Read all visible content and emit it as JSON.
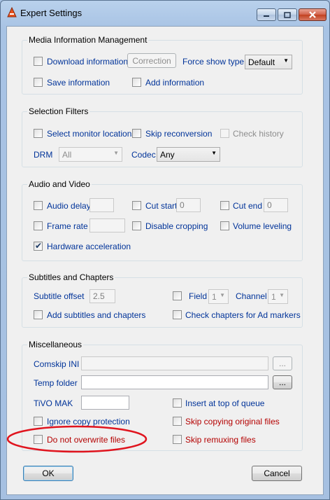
{
  "window": {
    "title": "Expert Settings",
    "minimize_icon": "minimize-icon",
    "maximize_icon": "maximize-icon",
    "close_icon": "close-icon"
  },
  "media": {
    "title": "Media Information Management",
    "download_information": "Download information",
    "correction_button": "Correction",
    "force_show_type_label": "Force show type",
    "force_show_type_value": "Default",
    "save_information": "Save information",
    "add_information": "Add information"
  },
  "selection": {
    "title": "Selection Filters",
    "select_monitor_locations": "Select monitor locations",
    "skip_reconversion": "Skip reconversion",
    "check_history": "Check history",
    "drm_label": "DRM",
    "drm_value": "All",
    "codec_label": "Codec",
    "codec_value": "Any"
  },
  "audio_video": {
    "title": "Audio and Video",
    "audio_delay": "Audio delay",
    "audio_delay_value": "",
    "cut_start": "Cut start",
    "cut_start_value": "0",
    "cut_end": "Cut end",
    "cut_end_value": "0",
    "frame_rate": "Frame rate",
    "frame_rate_value": "",
    "disable_cropping": "Disable cropping",
    "volume_leveling": "Volume leveling",
    "hardware_acceleration": "Hardware acceleration",
    "hardware_acceleration_checked": true
  },
  "subtitles": {
    "title": "Subtitles and Chapters",
    "subtitle_offset_label": "Subtitle offset",
    "subtitle_offset_value": "2.5",
    "field_label": "Field",
    "field_value": "1",
    "channel_label": "Channel",
    "channel_value": "1",
    "add_subtitles": "Add subtitles and chapters",
    "check_chapters": "Check chapters for Ad markers"
  },
  "misc": {
    "title": "Miscellaneous",
    "comskip_ini_label": "Comskip INI",
    "comskip_ini_value": "",
    "browse_label": "...",
    "temp_folder_label": "Temp folder",
    "temp_folder_value": "",
    "tivo_mak_label": "TiVO MAK",
    "tivo_mak_value": "",
    "insert_top_queue": "Insert at top of queue",
    "ignore_copy_protection": "Ignore copy protection",
    "skip_copying_original": "Skip copying original files",
    "do_not_overwrite": "Do not overwrite files",
    "skip_remuxing": "Skip remuxing files"
  },
  "footer": {
    "ok_label": "OK",
    "cancel_label": "Cancel"
  },
  "colors": {
    "label_blue": "#003399",
    "label_red": "#b40000",
    "annotation_red": "#e0141e"
  }
}
